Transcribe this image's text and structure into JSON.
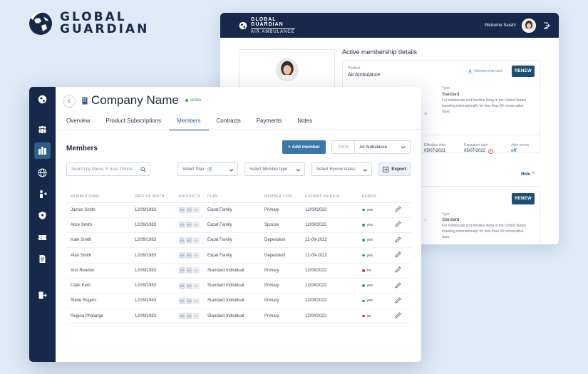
{
  "brand": {
    "line1": "GLOBAL",
    "line2": "GUARDIAN"
  },
  "back_window": {
    "logo_line1": "GLOBAL",
    "logo_line2": "GUARDIAN",
    "logo_sub": "AIR AMBULANCE",
    "welcome": "Welcome Sarah!",
    "section_title": "Active membership details",
    "product_label": "Product",
    "product_value": "Air Ambulance",
    "membership_card": "Membership card",
    "renew": "RENEW",
    "type_label": "Type",
    "type_value": "Standard",
    "type_desc": "For individuals and families living in the United States traveling internationally for less than 90 consecutive days.",
    "effective_label": "Effective date",
    "effective_value": "05/07/2021",
    "expiration_label": "Expiration date",
    "expiration_value": "05/07/2022",
    "autorenew_label": "Auto renew",
    "autorenew_value": "off",
    "hide": "Hide",
    "partial_e": "e",
    "partial_t": "t",
    "card2_renew": "RENEW",
    "card2_type_label": "Type",
    "card2_type_value": "Standard",
    "card2_type_desc": "For individuals and families living in the United States traveling internationally for less than 90 consecutive days."
  },
  "company": {
    "name": "Company Name",
    "status": "active"
  },
  "tabs": [
    "Overview",
    "Product Subscriptions",
    "Members",
    "Contracts",
    "Payments",
    "Notes"
  ],
  "members": {
    "title": "Members",
    "add_button": "+ Add member",
    "view_label": "VIEW",
    "view_value": "Air Ambulance",
    "search_placeholder": "Search by Name, E-mail, Phone...",
    "plan_filter": "Select Plan",
    "plan_count": "2",
    "type_filter": "Select Member type",
    "renew_filter": "Select Renew status",
    "export": "Export",
    "columns": [
      "MEMBER NAME",
      "DATE OF BIRTH",
      "PRODUCTS",
      "PLAN",
      "MEMBER TYPE",
      "EXPIRATION DATE",
      "RENEW"
    ],
    "product_tag": "AA",
    "rows": [
      {
        "name": "James Smith",
        "dob": "12/09/1983",
        "plan": "Expat Family",
        "type": "Primary",
        "exp": "12/09/2022",
        "renew": "yes"
      },
      {
        "name": "Alice Smith",
        "dob": "12/09/1983",
        "plan": "Expat Family",
        "type": "Spouse",
        "exp": "12/09/2022",
        "renew": "yes"
      },
      {
        "name": "Kate Smith",
        "dob": "12/09/1983",
        "plan": "Expat Family",
        "type": "Dependent",
        "exp": "12-09-2022",
        "renew": "yes"
      },
      {
        "name": "Alan Smith",
        "dob": "12/09/1983",
        "plan": "Expat Family",
        "type": "Dependent",
        "exp": "12-09-2022",
        "renew": "yes"
      },
      {
        "name": "Ann Readon",
        "dob": "12/09/1983",
        "plan": "Standard Individual",
        "type": "Primary",
        "exp": "12/09/2022",
        "renew": "no"
      },
      {
        "name": "Clark Kent",
        "dob": "12/09/1983",
        "plan": "Standard Individual",
        "type": "Primary",
        "exp": "12/09/2022",
        "renew": "yes"
      },
      {
        "name": "Steve Rogers",
        "dob": "12/09/1983",
        "plan": "Standard Individual",
        "type": "Primary",
        "exp": "12/09/2022",
        "renew": "yes"
      },
      {
        "name": "Regina Phalange",
        "dob": "12/09/1983",
        "plan": "Standard Individual",
        "type": "Primary",
        "exp": "12/09/2022",
        "renew": "no"
      }
    ]
  },
  "colors": {
    "navy": "#16294a",
    "accent": "#2d5d89",
    "yes": "#2ea44f",
    "no": "#d93838"
  }
}
